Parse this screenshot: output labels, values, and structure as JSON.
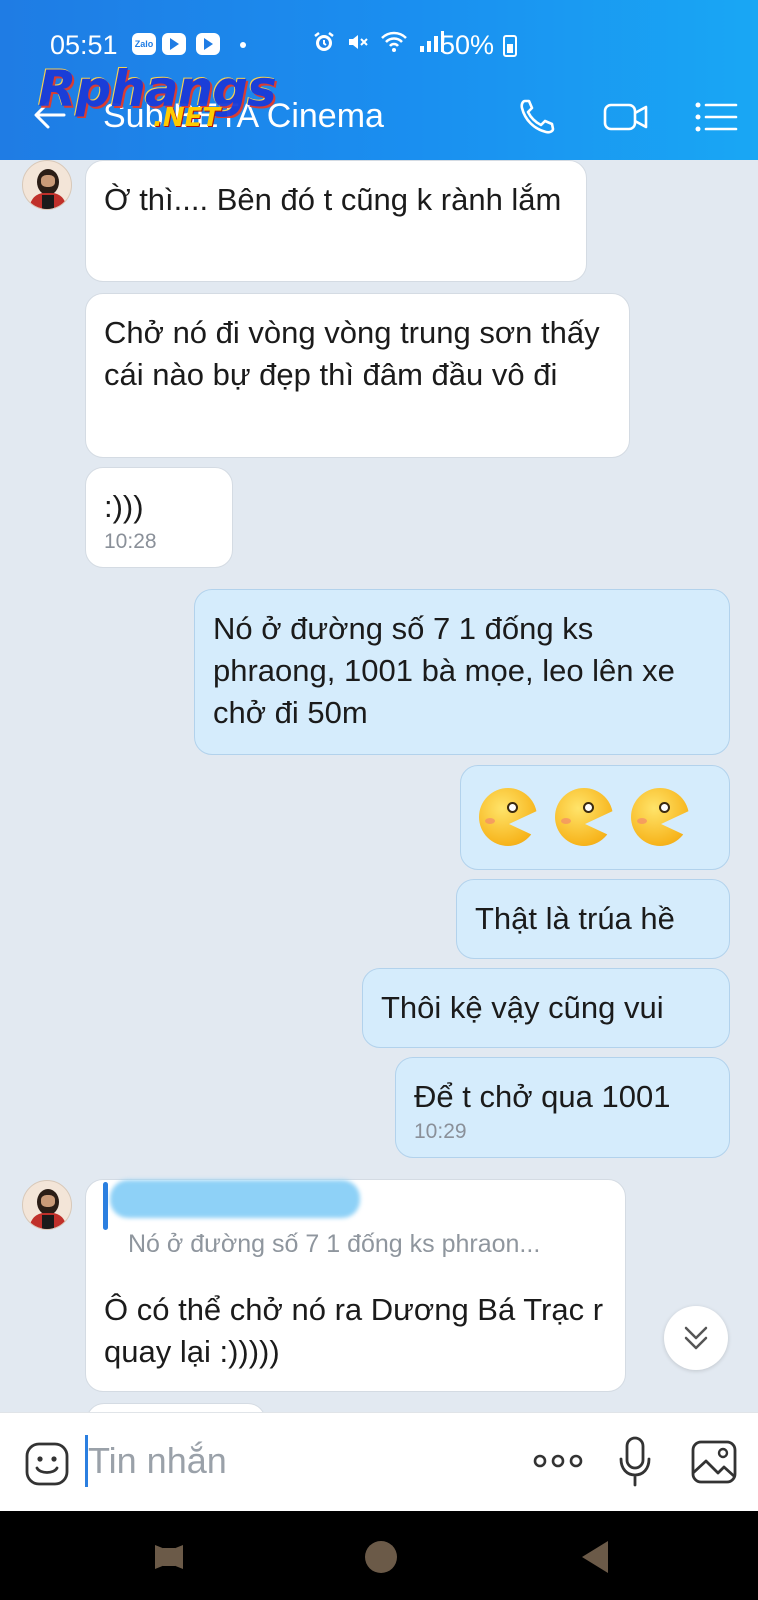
{
  "status_bar": {
    "time": "05:51",
    "zalo_label": "Zalo",
    "battery": "50%",
    "icons": [
      "alarm-icon",
      "mute-icon",
      "wifi-icon",
      "signal-icon"
    ]
  },
  "header": {
    "title": "Sub BETA Cinema",
    "watermark": "Rphangs",
    "watermark_suffix": ".NET",
    "actions": [
      "call-icon",
      "video-call-icon",
      "menu-icon"
    ]
  },
  "messages": [
    {
      "side": "in",
      "text": "Ờ thì.... Bên đó t cũng k rành lắm"
    },
    {
      "side": "in",
      "text": "Chở nó đi vòng vòng trung sơn thấy cái nào bự đẹp thì đâm đầu vô đi"
    },
    {
      "side": "in",
      "text": ":)))",
      "time": "10:28"
    },
    {
      "side": "out",
      "text": "Nó ở đường số 7 1 đống ks phraong, 1001 bà mọe, leo lên xe chở đi 50m"
    },
    {
      "side": "out",
      "emoji": [
        "grin-emoji",
        "grin-emoji",
        "grin-emoji"
      ]
    },
    {
      "side": "out",
      "text": "Thật là trúa hề"
    },
    {
      "side": "out",
      "text": "Thôi kệ vậy cũng vui"
    },
    {
      "side": "out",
      "text": "Để t chở qua 1001",
      "time": "10:29"
    },
    {
      "side": "in",
      "quote": "Nó ở đường số 7 1 đống ks phraon...",
      "text": "Ô có thể chở nó ra Dương Bá Trạc r quay lại  :)))))"
    }
  ],
  "composer": {
    "placeholder": "Tin nhắn"
  },
  "colors": {
    "header_start": "#1f7ce4",
    "header_end": "#19a7f4",
    "incoming_bubble": "#ffffff",
    "outgoing_bubble": "#d5ecfc",
    "chat_background": "#e2e9f1",
    "accent": "#2b7fe0"
  }
}
